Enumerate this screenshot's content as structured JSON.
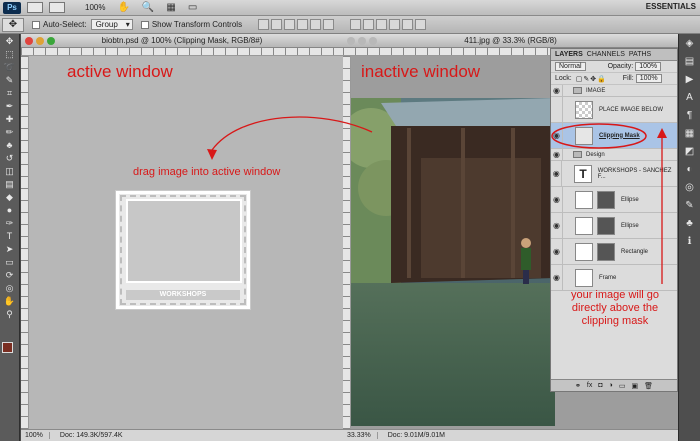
{
  "app": {
    "logo": "Ps",
    "zoom": "100%",
    "workspace": "ESSENTIALS"
  },
  "options": {
    "auto_select_label": "Auto-Select:",
    "auto_select_value": "Group",
    "show_transform_label": "Show Transform Controls"
  },
  "active_doc": {
    "title": "biobtn.psd @ 100% (Clipping Mask, RGB/8#)",
    "status_zoom": "100%",
    "status_doc": "Doc: 149.3K/597.4K",
    "label_window": "active window",
    "label_drag": "drag image into active window",
    "frame_text": "WORKSHOPS"
  },
  "inactive_doc": {
    "title": "411.jpg @ 33.3% (RGB/8)",
    "status_zoom": "33.33%",
    "status_doc": "Doc: 9.01M/9.01M",
    "label_window": "inactive window"
  },
  "layers_panel": {
    "tabs": [
      "LAYERS",
      "CHANNELS",
      "PATHS"
    ],
    "blend_mode": "Normal",
    "opacity_label": "Opacity:",
    "opacity_value": "100%",
    "lock_label": "Lock:",
    "fill_label": "Fill:",
    "fill_value": "100%",
    "group_image": "IMAGE",
    "layer_place": "PLACE IMAGE BELOW",
    "layer_clipping": "Clipping Mask",
    "group_design": "Design",
    "layer_text": "WORKSHOPS - SANCHEZ F...",
    "layer_ellipse1": "Ellipse",
    "layer_ellipse2": "Ellipse",
    "layer_rectangle": "Rectangle",
    "layer_frame": "Frame",
    "text_thumb": "T"
  },
  "annotation": {
    "note": "your image will go directly above the clipping mask"
  },
  "colors": {
    "annotation_red": "#d81818",
    "foreground_swatch": "#7a2e22",
    "selection_blue": "#aac4e6"
  }
}
